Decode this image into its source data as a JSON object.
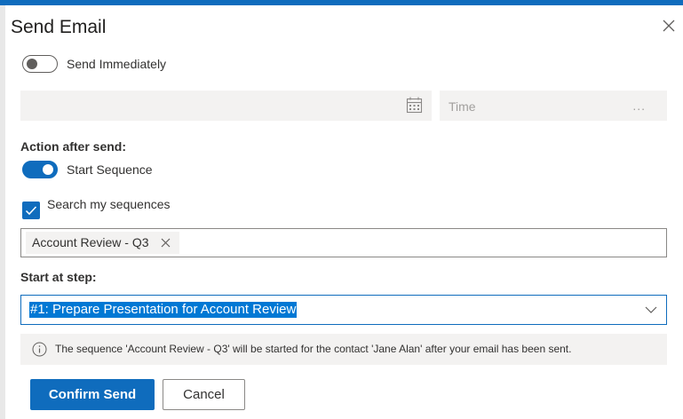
{
  "dialog": {
    "title": "Send Email"
  },
  "send_immediately": {
    "label": "Send Immediately",
    "enabled": false
  },
  "schedule": {
    "date_value": "",
    "time_placeholder": "Time",
    "time_dots": "..."
  },
  "action_after_send": {
    "heading": "Action after send:",
    "start_sequence_label": "Start Sequence",
    "start_sequence_enabled": true
  },
  "search_sequences": {
    "label": "Search my sequences",
    "checked": true
  },
  "selected_sequence": {
    "tag_label": "Account Review - Q3"
  },
  "start_step": {
    "heading": "Start at step:",
    "selected": "#1: Prepare Presentation for Account Review"
  },
  "info_message": "The sequence 'Account Review - Q3' will be started for the contact 'Jane Alan' after your email has been sent.",
  "buttons": {
    "confirm": "Confirm Send",
    "cancel": "Cancel"
  },
  "colors": {
    "accent": "#0f6cbd",
    "selection": "#0078d4",
    "field_bg": "#f3f2f1"
  }
}
